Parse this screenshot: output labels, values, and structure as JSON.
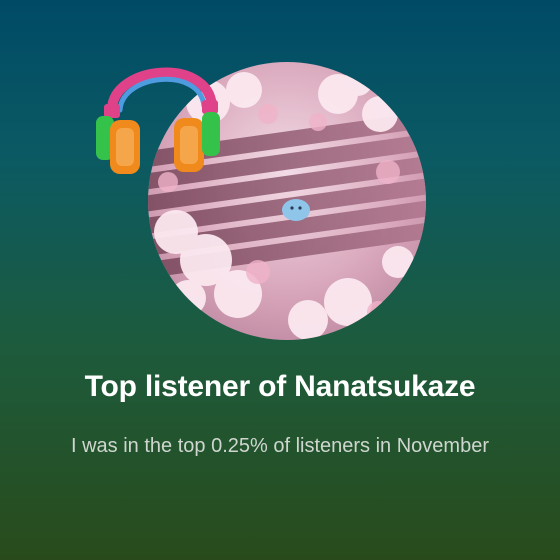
{
  "card": {
    "title": "Top listener of Nanatsukaze",
    "subtitle": "I was in the top 0.25% of listeners in November"
  },
  "artwork": {
    "icon": "headphones-icon",
    "image": "cherry-blossom-artwork"
  },
  "colors": {
    "background_top": "#004a66",
    "background_bottom": "#294b1b",
    "title_text": "#ffffff",
    "subtitle_text": "#cfd6d0",
    "headphone_band": "#e0428a",
    "headphone_cup_green": "#34c24b",
    "headphone_cup_orange": "#f08a1c"
  }
}
